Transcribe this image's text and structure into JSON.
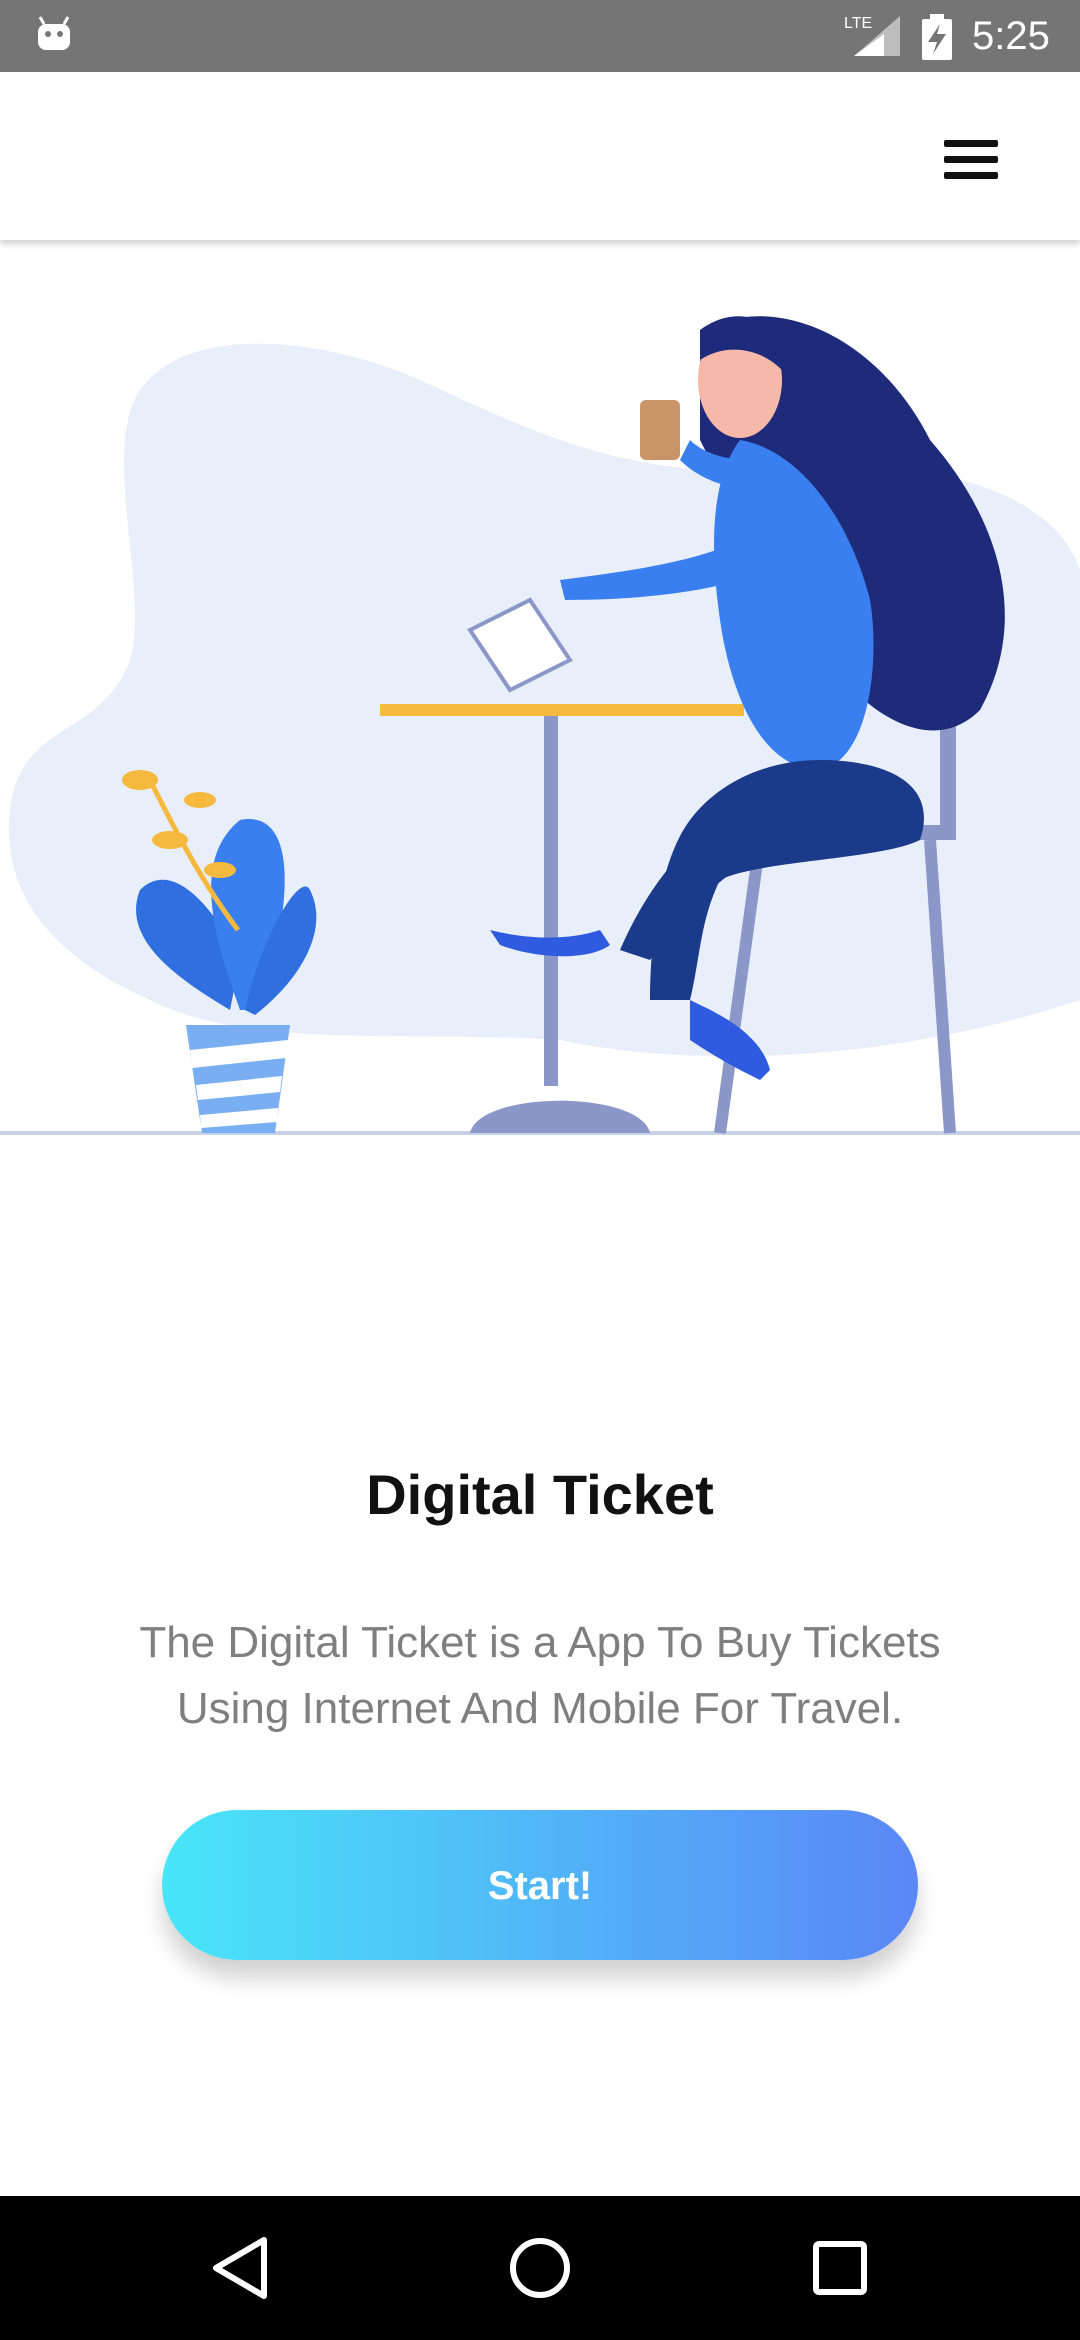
{
  "status_bar": {
    "time": "5:25",
    "network_label": "LTE",
    "icons": [
      "android-icon",
      "lte-signal-icon",
      "battery-charging-icon"
    ]
  },
  "app_bar": {
    "menu_icon": "hamburger-menu-icon"
  },
  "content": {
    "title": "Digital Ticket",
    "description": "The Digital Ticket is a App To Buy Tickets Using Internet And Mobile For Travel.",
    "start_label": "Start!",
    "illustration": "woman-at-table-with-phone-illustration"
  },
  "nav_bar": {
    "icons": [
      "back-icon",
      "home-icon",
      "recents-icon"
    ]
  },
  "colors": {
    "status_bar": "#757575",
    "button_gradient_start": "#48e6f8",
    "button_gradient_end": "#5a87f7",
    "title": "#111111",
    "description": "#7f7f7f"
  }
}
